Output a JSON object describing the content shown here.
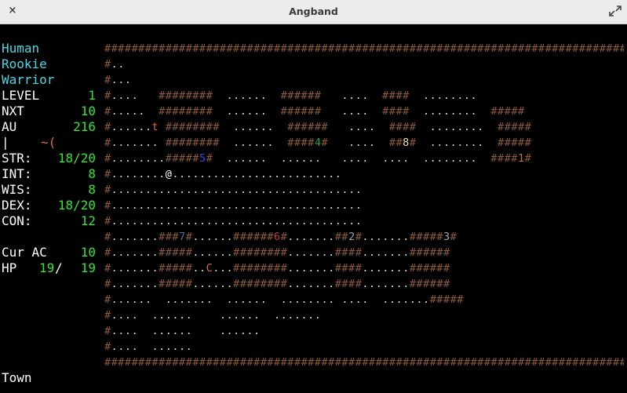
{
  "window": {
    "title": "Angband",
    "close_label": "×"
  },
  "sidebar": {
    "race": "Human",
    "title": "Rookie",
    "class": "Warrior",
    "level_label": "LEVEL",
    "level_value": "1",
    "nxt_label": "NXT",
    "nxt_value": "10",
    "au_label": "AU",
    "au_value": "216",
    "equip_bar": "|",
    "equip_items": "~(",
    "str_label": "STR:",
    "str_value": "18/20",
    "int_label": "INT:",
    "int_value": "8",
    "wis_label": "WIS:",
    "wis_value": "8",
    "dex_label": "DEX:",
    "dex_value": "18/20",
    "con_label": "CON:",
    "con_value": "12",
    "ac_label": "Cur AC",
    "ac_value": "10",
    "hp_label": "HP",
    "hp_current": "19",
    "hp_sep": "/",
    "hp_max": "19",
    "location": "Town"
  },
  "map": {
    "colors": {
      "wall": "#8c5a3a",
      "floor": "#d8d8d8",
      "player": "#ffffff",
      "shop_1": "#c8743c",
      "shop_2": "#a0a0a0",
      "shop_3": "#a0a0a0",
      "shop_4": "#2e9e3e",
      "shop_5": "#2f4fd6",
      "shop_6": "#c43a2a",
      "shop_7": "#4a6aa8",
      "shop_8": "#f0e0a0",
      "monster_t": "#d87040",
      "monster_C": "#d87040"
    },
    "rows": [
      "################################################################################",
      "#..                                                                            #",
      "#...                                                                           #",
      "#....   ########  ......  ######   ....  ####  ........                        #",
      "#.....  ########  ......  ######   ....  ####  ........  #####                 #",
      "#......t ########  ......  ######   ....  ####  ........  #####                 #",
      "#....... ########  ......  ####4#   ....  ##8#  ........  #####                 #",
      "#........#####5#  ......  ......   ....  ....  ........  ####1#                 #",
      "#........@.........................                                              #",
      "#.....................................                                           #",
      "#.....................................                                           #",
      "#.....................................                                           #",
      "#.......###7#......######6#.......##2#.......#####3#                            #",
      "#.......#####......########.......####.......######                             #",
      "#.......#####..C...########.......####.......######                             #",
      "#.......#####......########.......####.......######                             #",
      "#......  .......  ......  ........ ....  .......#####                            #",
      "#....  ......    ......  .......                                                #",
      "#....  ......    ......                                                         #",
      "#....  ......                                                                   #",
      "################################################################################"
    ]
  }
}
